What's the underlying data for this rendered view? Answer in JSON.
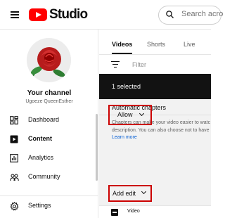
{
  "header": {
    "logo_text": "Studio",
    "search_placeholder": "Search acro"
  },
  "sidebar": {
    "channel_title": "Your channel",
    "channel_name": "Ugoeze QueenEsther",
    "items": [
      {
        "label": "Dashboard",
        "icon": "dashboard-icon"
      },
      {
        "label": "Content",
        "icon": "content-icon",
        "active": true
      },
      {
        "label": "Analytics",
        "icon": "analytics-icon"
      },
      {
        "label": "Community",
        "icon": "community-icon"
      },
      {
        "label": "Settings",
        "icon": "gear-icon"
      }
    ]
  },
  "main": {
    "tabs": [
      {
        "label": "Videos",
        "active": true
      },
      {
        "label": "Shorts"
      },
      {
        "label": "Live"
      }
    ],
    "filter_label": "Filter",
    "selected_text": "1 selected",
    "panel": {
      "title": "Automatic chapters",
      "description_line1": "Chapters can make your video easier to watc",
      "description_line2": "description. You can also choose not to have",
      "learn_more": "Learn more",
      "allow_label": "Allow"
    },
    "add_edit_label": "Add edit",
    "row_label": "Video"
  },
  "colors": {
    "brand_red": "#ff0000",
    "highlight_red": "#cc0000",
    "link_blue": "#065fd4",
    "selected_bar": "#121212",
    "panel_bg": "#f2f2f2"
  }
}
